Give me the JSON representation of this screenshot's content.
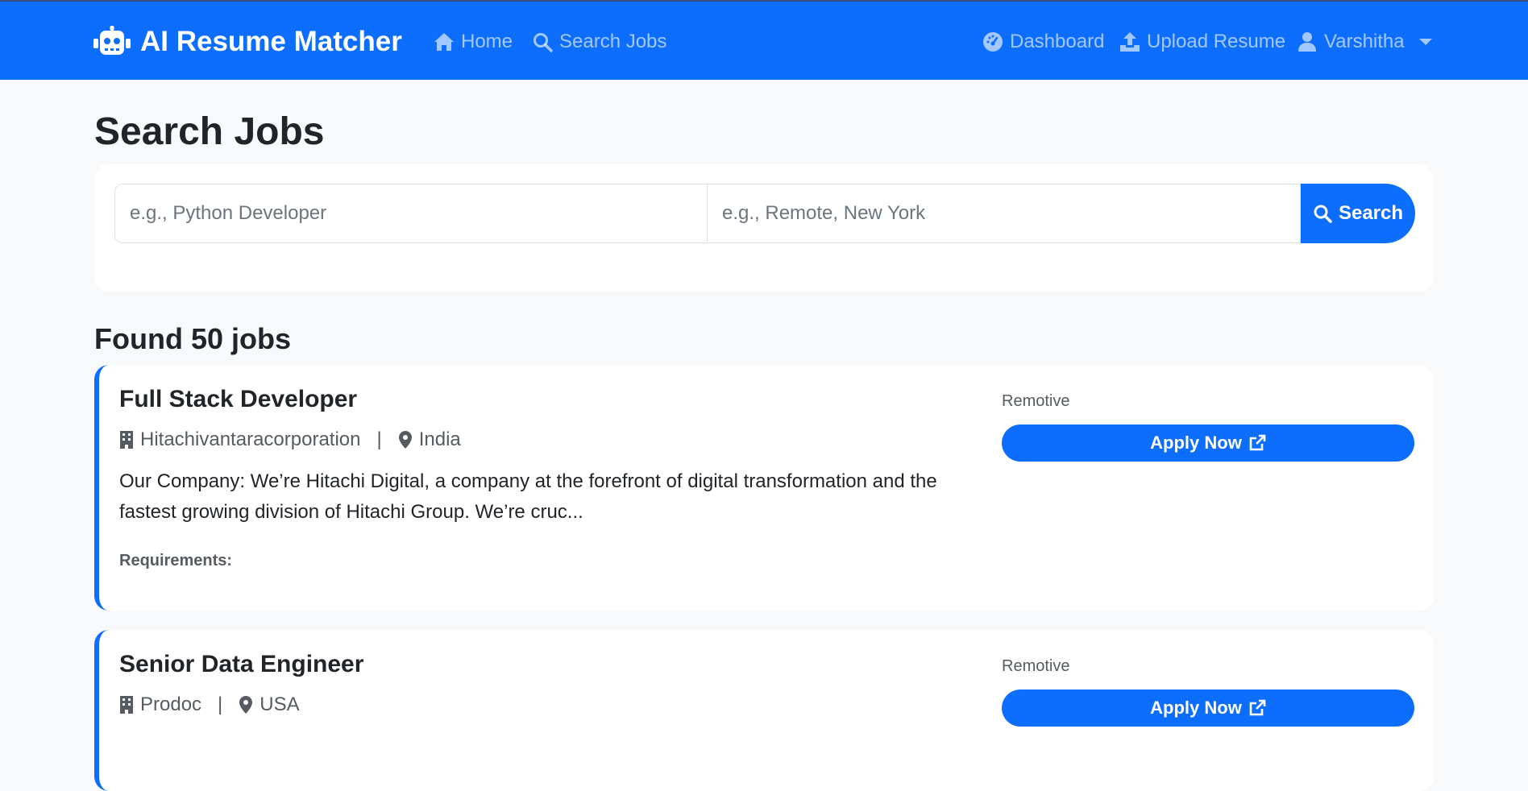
{
  "navbar": {
    "brand": "AI Resume Matcher",
    "links": [
      {
        "label": "Home",
        "icon": "home-icon"
      },
      {
        "label": "Search Jobs",
        "icon": "search-icon"
      }
    ],
    "right_links": [
      {
        "label": "Dashboard",
        "icon": "dashboard-icon"
      },
      {
        "label": "Upload Resume",
        "icon": "upload-icon"
      }
    ],
    "user": {
      "label": "Varshitha",
      "icon": "user-icon"
    }
  },
  "page": {
    "title": "Search Jobs"
  },
  "search": {
    "keyword_placeholder": "e.g., Python Developer",
    "keyword_value": "",
    "location_placeholder": "e.g., Remote, New York",
    "location_value": "",
    "button_label": "Search"
  },
  "results": {
    "heading": "Found 50 jobs",
    "jobs": [
      {
        "title": "Full Stack Developer",
        "company": "Hitachivantaracorporation",
        "location": "India",
        "description": "Our Company: We’re Hitachi Digital, a company at the forefront of digital transformation and the fastest growing division of Hitachi Group. We’re cruc...",
        "requirements_label": "Requirements:",
        "source": "Remotive",
        "apply_label": "Apply Now"
      },
      {
        "title": "Senior Data Engineer",
        "company": "Prodoc",
        "location": "USA",
        "description": "",
        "requirements_label": "",
        "source": "Remotive",
        "apply_label": "Apply Now"
      }
    ]
  },
  "colors": {
    "primary": "#0d6efd",
    "background": "#f8f9fa",
    "card": "#ffffff",
    "muted_text": "#555b61"
  }
}
